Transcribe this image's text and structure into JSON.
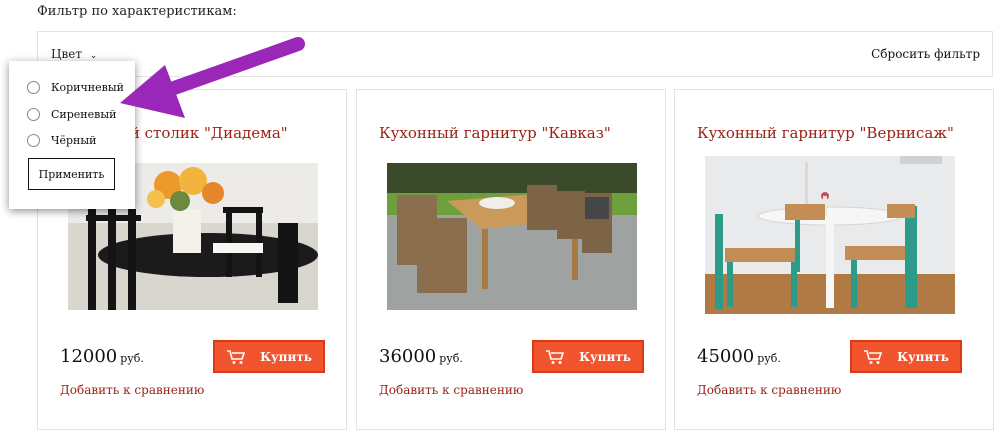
{
  "filter": {
    "title": "Фильтр по характеристикам:",
    "color_label": "Цвет",
    "reset_label": "Сбросить фильтр",
    "options": [
      "Коричневый",
      "Сиреневый",
      "Чёрный"
    ],
    "apply_label": "Применить"
  },
  "products": [
    {
      "title": "Кухонный столик \"Диадема\"",
      "price": "12000",
      "currency": "руб.",
      "buy_label": "Купить",
      "compare_label": "Добавить к сравнению"
    },
    {
      "title": "Кухонный гарнитур \"Кавказ\"",
      "price": "36000",
      "currency": "руб.",
      "buy_label": "Купить",
      "compare_label": "Добавить к сравнению"
    },
    {
      "title": "Кухонный гарнитур \"Вернисаж\"",
      "price": "45000",
      "currency": "руб.",
      "buy_label": "Купить",
      "compare_label": "Добавить к сравнению"
    }
  ],
  "colors": {
    "accent": "#f2542d",
    "title_red": "#9b2214",
    "annotation_arrow": "#9b27b8"
  },
  "icons": {
    "cart": "cart-icon",
    "chevron": "chevron-down-icon",
    "radio": "radio-icon"
  }
}
